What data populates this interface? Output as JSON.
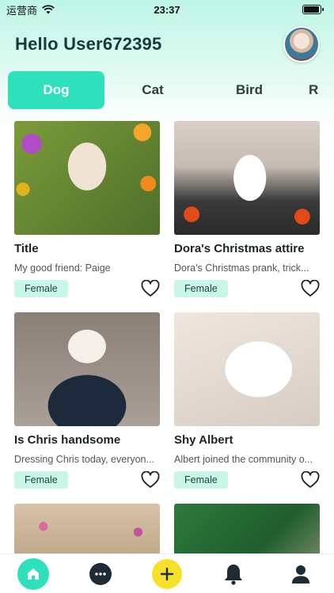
{
  "status_bar": {
    "carrier": "运营商",
    "time": "23:37",
    "battery_level": 0.95
  },
  "header": {
    "greeting": "Hello User672395"
  },
  "tabs": [
    {
      "label": "Dog",
      "active": true
    },
    {
      "label": "Cat",
      "active": false
    },
    {
      "label": "Bird",
      "active": false
    },
    {
      "label": "R",
      "active": false
    }
  ],
  "cards": [
    {
      "title": "Title",
      "description": "My good friend: Paige",
      "badge": "Female"
    },
    {
      "title": "Dora's Christmas attire",
      "description": "Dora's Christmas prank, trick...",
      "badge": "Female"
    },
    {
      "title": "Is Chris handsome",
      "description": "Dressing Chris today, everyon...",
      "badge": "Female"
    },
    {
      "title": "Shy Albert",
      "description": "Albert joined the community o...",
      "badge": "Female"
    }
  ],
  "bottom_nav": [
    {
      "icon": "home-icon",
      "color": "#2ee0bc"
    },
    {
      "icon": "chat-icon",
      "color": "#1c2b35"
    },
    {
      "icon": "add-icon",
      "color": "#f6e02a"
    },
    {
      "icon": "bell-icon",
      "color": "#1c2b35"
    },
    {
      "icon": "user-icon",
      "color": "#1c2b35"
    }
  ],
  "colors": {
    "accent": "#2ee0bc",
    "badge_bg": "#c8f7ea",
    "add_button": "#f6e02a"
  }
}
